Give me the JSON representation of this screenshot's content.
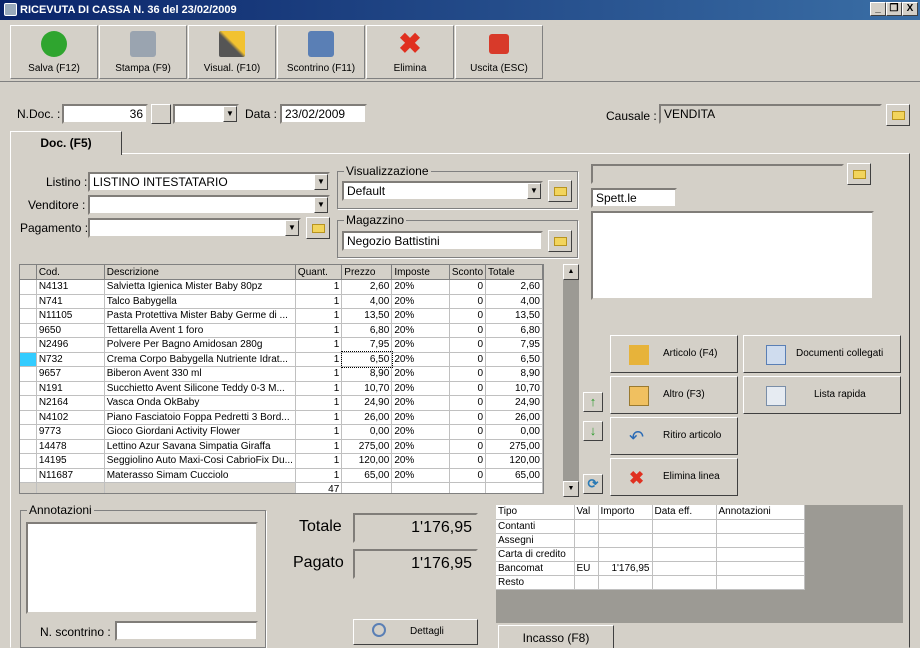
{
  "window": {
    "title": "RICEVUTA DI CASSA N. 36  del 23/02/2009",
    "ctrl_min": "_",
    "ctrl_restore": "❐",
    "ctrl_close": "X"
  },
  "toolbar": [
    {
      "label": "Salva (F12)",
      "icon": "check-icon",
      "color": "#2fa52f"
    },
    {
      "label": "Stampa (F9)",
      "icon": "printer-icon",
      "color": "#9aa4b0"
    },
    {
      "label": "Visual. (F10)",
      "icon": "magic-wand-icon",
      "color": "#7a7a7a"
    },
    {
      "label": "Scontrino (F11)",
      "icon": "cash-register-icon",
      "color": "#5a7fb5"
    },
    {
      "label": "Elimina",
      "icon": "x-icon",
      "color": "#e03020"
    },
    {
      "label": "Uscita (ESC)",
      "icon": "power-icon",
      "color": "#d83a2a"
    }
  ],
  "header": {
    "ndoc_label": "N.Doc. :",
    "ndoc_value": "36",
    "data_label": "Data :",
    "data_value": "23/02/2009",
    "causale_label": "Causale :",
    "causale_value": "VENDITA"
  },
  "tabs": {
    "doc": "Doc. (F5)",
    "incasso": "Incasso (F8)"
  },
  "form": {
    "listino_label": "Listino :",
    "listino_value": "LISTINO INTESTATARIO",
    "venditore_label": "Venditore :",
    "pagamento_label": "Pagamento :",
    "visualizzazione_title": "Visualizzazione",
    "visualizzazione_value": "Default",
    "magazzino_title": "Magazzino",
    "magazzino_value": "Negozio Battistini",
    "spett": "Spett.le"
  },
  "grid": {
    "columns": [
      "Cod.",
      "Descrizione",
      "Quant.",
      "Prezzo",
      "Imposte",
      "Sconto",
      "Totale"
    ],
    "rows": [
      [
        "N4131",
        "Salvietta Igienica Mister Baby 80pz",
        "1",
        "2,60",
        "20%",
        "0",
        "2,60"
      ],
      [
        "N741",
        "Talco Babygella",
        "1",
        "4,00",
        "20%",
        "0",
        "4,00"
      ],
      [
        "N11105",
        "Pasta Protettiva Mister Baby Germe di ...",
        "1",
        "13,50",
        "20%",
        "0",
        "13,50"
      ],
      [
        "9650",
        "Tettarella Avent 1 foro",
        "1",
        "6,80",
        "20%",
        "0",
        "6,80"
      ],
      [
        "N2496",
        "Polvere Per Bagno Amidosan 280g",
        "1",
        "7,95",
        "20%",
        "0",
        "7,95"
      ],
      [
        "N732",
        "Crema Corpo Babygella Nutriente Idrat...",
        "1",
        "6,50",
        "20%",
        "0",
        "6,50"
      ],
      [
        "9657",
        "Biberon Avent 330 ml",
        "1",
        "8,90",
        "20%",
        "0",
        "8,90"
      ],
      [
        "N191",
        "Succhietto Avent Silicone Teddy 0-3 M...",
        "1",
        "10,70",
        "20%",
        "0",
        "10,70"
      ],
      [
        "N2164",
        "Vasca Onda OkBaby",
        "1",
        "24,90",
        "20%",
        "0",
        "24,90"
      ],
      [
        "N4102",
        "Piano Fasciatoio Foppa Pedretti 3 Bord...",
        "1",
        "26,00",
        "20%",
        "0",
        "26,00"
      ],
      [
        "9773",
        "Gioco Giordani Activity Flower",
        "1",
        "0,00",
        "20%",
        "0",
        "0,00"
      ],
      [
        "14478",
        "Lettino Azur Savana Simpatia Giraffa",
        "1",
        "275,00",
        "20%",
        "0",
        "275,00"
      ],
      [
        "14195",
        "Seggiolino Auto Maxi-Cosi CabrioFix Du...",
        "1",
        "120,00",
        "20%",
        "0",
        "120,00"
      ],
      [
        "N11687",
        "Materasso Simam Cucciolo",
        "1",
        "65,00",
        "20%",
        "0",
        "65,00"
      ]
    ],
    "total_qty": "47",
    "selected_row": 5
  },
  "actions": {
    "articolo": "Articolo (F4)",
    "altro": "Altro (F3)",
    "ritiro": "Ritiro articolo",
    "elimina_linea": "Elimina linea",
    "documenti": "Documenti collegati",
    "lista": "Lista rapida"
  },
  "bottom": {
    "annotazioni_title": "Annotazioni",
    "scontrino_label": "N. scontrino :",
    "totale_label": "Totale",
    "totale_value": "1'176,95",
    "pagato_label": "Pagato",
    "pagato_value": "1'176,95",
    "dettagli": "Dettagli"
  },
  "payments": {
    "columns": [
      "Tipo",
      "Val",
      "Importo",
      "Data eff.",
      "Annotazioni"
    ],
    "rows": [
      [
        "Contanti",
        "",
        "",
        "",
        ""
      ],
      [
        "Assegni",
        "",
        "",
        "",
        ""
      ],
      [
        "Carta di credito",
        "",
        "",
        "",
        ""
      ],
      [
        "Bancomat",
        "EU",
        "1'176,95",
        "",
        ""
      ],
      [
        "Resto",
        "",
        "",
        "",
        ""
      ]
    ]
  }
}
